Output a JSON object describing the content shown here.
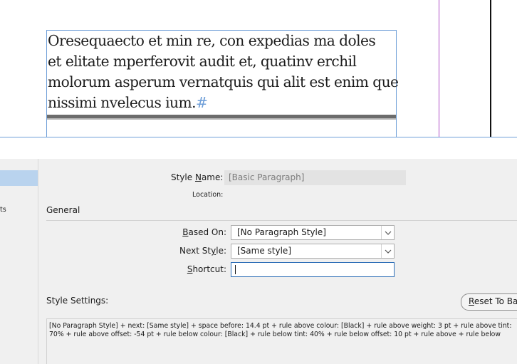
{
  "document": {
    "text_lines": [
      "Oresequaecto et min re, con expedias ma doles",
      "et elitate mperferovit audit et, quatinv erchil",
      "molorum asperum vernatquis qui alit est enim que",
      "nissimi nvelecus ium."
    ],
    "paragraph_mark": "#"
  },
  "sidebar": {
    "partial_item": "ts"
  },
  "dialog": {
    "style_name_label_pre": "Style ",
    "style_name_label_ul": "N",
    "style_name_label_post": "ame:",
    "style_name_value": "[Basic Paragraph]",
    "location_label": "Location:",
    "section_title": "General",
    "based_on_label_ul": "B",
    "based_on_label_post": "ased On:",
    "based_on_value": "[No Paragraph Style]",
    "next_style_label_pre": "Next St",
    "next_style_label_ul": "y",
    "next_style_label_post": "le:",
    "next_style_value": "[Same style]",
    "shortcut_label_ul": "S",
    "shortcut_label_post": "hortcut:",
    "shortcut_value": "",
    "style_settings_label": "Style Settings:",
    "reset_button_ul": "R",
    "reset_button_post": "eset To Ba",
    "style_settings_lines": [
      "[No Paragraph Style] + next: [Same style] + space before: 14.4 pt + rule above colour: [Black] + rule above weight: 3 pt + rule above tint:",
      "70% + rule above offset: -54 pt + rule below colour: [Black] + rule below tint: 40% + rule below offset: 10 pt + rule above + rule below"
    ]
  },
  "icons": {
    "dropdown": "chevron-down-icon"
  },
  "colors": {
    "frame_border": "#6f9fd8",
    "margin_guide": "#b04fc7",
    "selection": "#b9d3ee",
    "focus_border": "#2e6fb7"
  }
}
